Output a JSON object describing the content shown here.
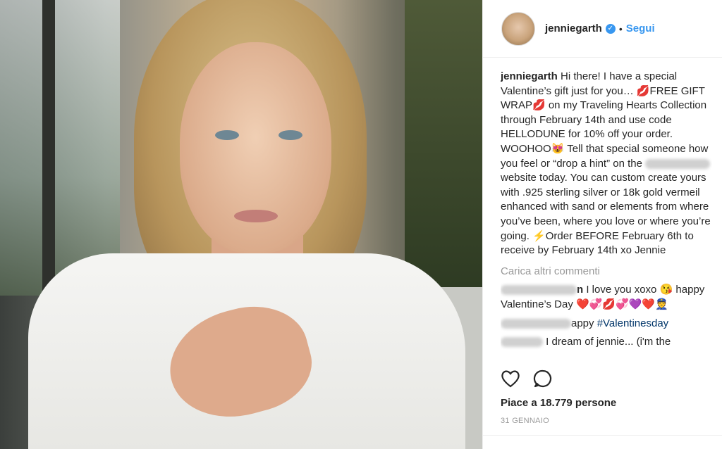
{
  "post": {
    "username": "jenniegarth",
    "dot": "•",
    "follow_label": "Segui",
    "caption": "Hi there! I have a special Valentine’s gift just for you… 💋FREE GIFT WRAP💋 on my Traveling Hearts Collection through February 14th and use code HELLODUNE for 10% off your order.  WOOHOO😻 Tell that special someone how you feel or “drop a hint” on the",
    "caption_tail": "website today.  You can custom create yours with .925 sterling silver or 18k gold vermeil enhanced with sand or elements from where you’ve been, where you love or where you’re going. ⚡Order BEFORE February 6th to receive by February 14th xo Jennie",
    "load_more": "Carica altri commenti",
    "comments": [
      {
        "username_suffix": "n",
        "text": "I love you xoxo 😘 happy Valentine’s Day ❤️💞💋💞💜❤️👮"
      },
      {
        "username_suffix": "",
        "text": "appy",
        "hashtag": "#Valentinesday"
      },
      {
        "username_suffix": "",
        "text": "I dream of jennie... (i'm the"
      }
    ],
    "likes": "Piace a 18.779 persone",
    "date": "31 GENNAIO"
  },
  "icons": {
    "like": "heart-icon",
    "comment": "comment-icon",
    "verified": "verified-icon"
  },
  "colors": {
    "accent": "#3897f0",
    "text": "#262626",
    "muted": "#999999"
  }
}
